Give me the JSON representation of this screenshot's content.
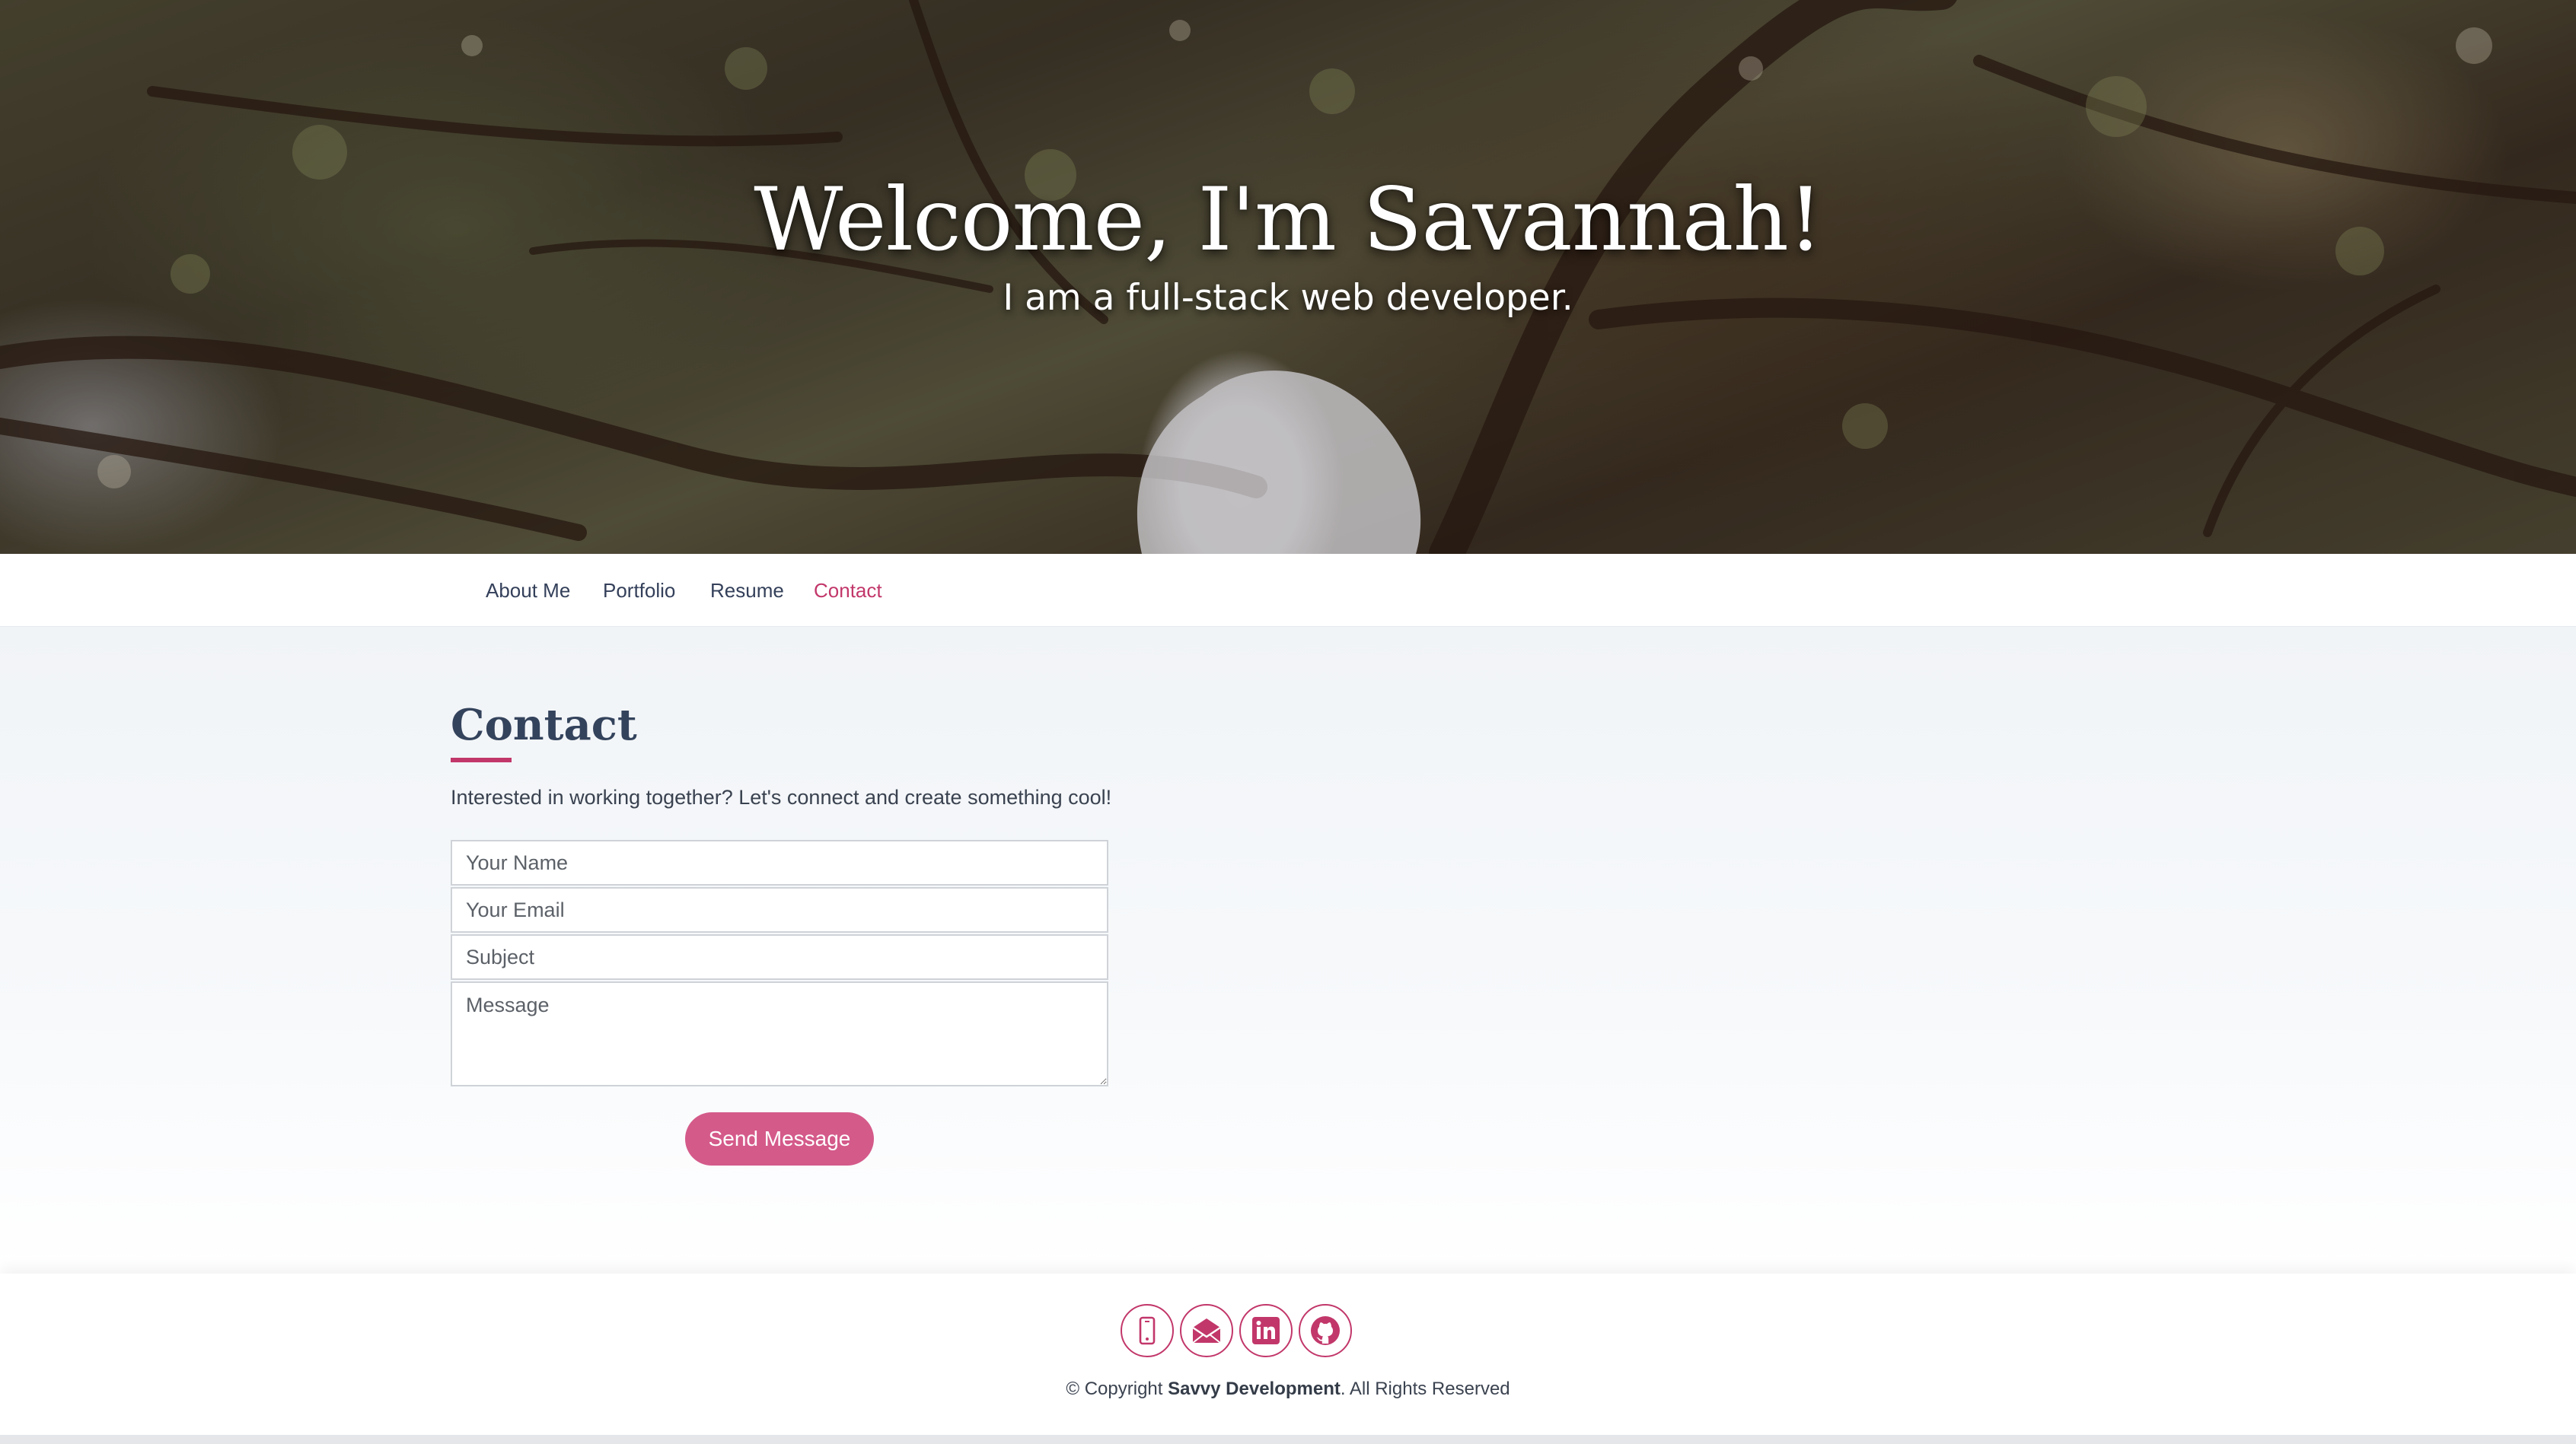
{
  "hero": {
    "title": "Welcome, I'm Savannah!",
    "subtitle": "I am a full-stack web developer."
  },
  "nav": {
    "items": [
      {
        "label": "About Me",
        "active": false
      },
      {
        "label": "Portfolio",
        "active": false
      },
      {
        "label": "Resume",
        "active": false
      },
      {
        "label": "Contact",
        "active": true
      }
    ]
  },
  "contact": {
    "title": "Contact",
    "intro": "Interested in working together? Let's connect and create something cool!",
    "form": {
      "name_placeholder": "Your Name",
      "email_placeholder": "Your Email",
      "subject_placeholder": "Subject",
      "message_placeholder": "Message",
      "name_value": "",
      "email_value": "",
      "subject_value": "",
      "message_value": "",
      "submit_label": "Send Message"
    }
  },
  "footer": {
    "social": [
      {
        "icon": "phone-icon"
      },
      {
        "icon": "envelope-icon"
      },
      {
        "icon": "linkedin-icon"
      },
      {
        "icon": "github-icon"
      }
    ],
    "copyright_prefix": "© Copyright ",
    "copyright_brand": "Savvy Development",
    "copyright_suffix": ". All Rights Reserved"
  },
  "colors": {
    "accent": "#c2376a",
    "button": "#d45a8a",
    "heading": "#34435c",
    "nav_text": "#34405a"
  }
}
